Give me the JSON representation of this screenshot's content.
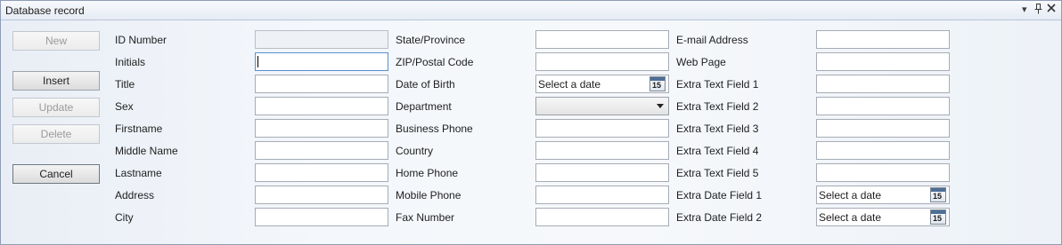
{
  "window": {
    "title": "Database record"
  },
  "buttons": {
    "new": "New",
    "insert": "Insert",
    "update": "Update",
    "delete": "Delete",
    "cancel": "Cancel"
  },
  "labels": {
    "col1": [
      "ID Number",
      "Initials",
      "Title",
      "Sex",
      "Firstname",
      "Middle Name",
      "Lastname",
      "Address",
      "City"
    ],
    "col2": [
      "State/Province",
      "ZIP/Postal Code",
      "Date of Birth",
      "Department",
      "Business Phone",
      "Country",
      "Home Phone",
      "Mobile Phone",
      "Fax Number"
    ],
    "col3": [
      "E-mail Address",
      "Web Page",
      "Extra Text Field 1",
      "Extra Text Field 2",
      "Extra Text Field 3",
      "Extra Text Field 4",
      "Extra Text Field 5",
      "Extra Date Field 1",
      "Extra Date Field 2"
    ]
  },
  "dates": {
    "date_of_birth": "Select a date",
    "extra_date_1": "Select a date",
    "extra_date_2": "Select a date",
    "calendar_day": "15"
  },
  "icons": {
    "dropdown": "chevron-down-icon",
    "pin": "pin-icon",
    "close": "close-icon",
    "calendar": "calendar-icon"
  }
}
